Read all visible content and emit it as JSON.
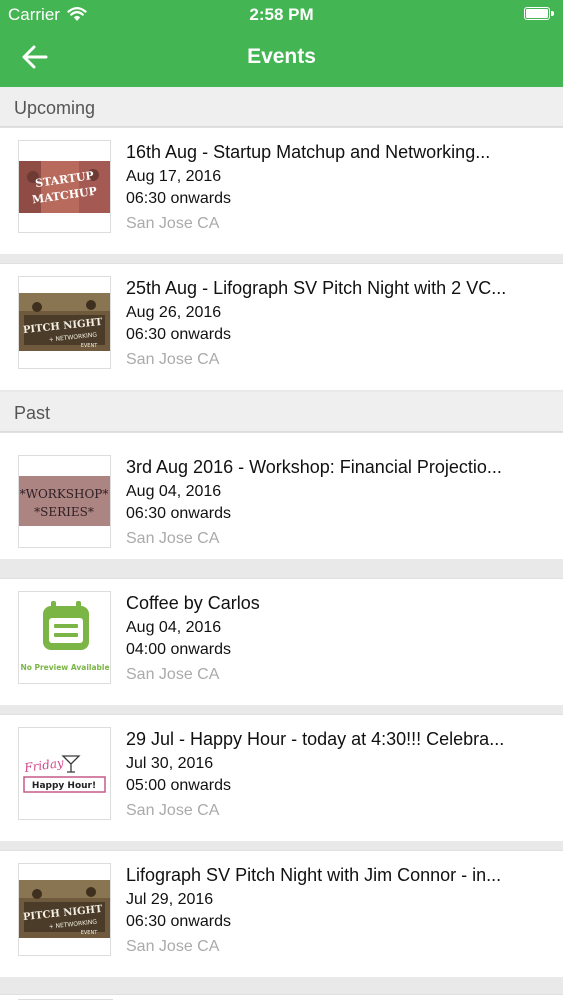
{
  "status_bar": {
    "carrier": "Carrier",
    "time": "2:58 PM"
  },
  "header": {
    "title": "Events"
  },
  "sections": [
    {
      "label": "Upcoming",
      "events": [
        {
          "title": "16th Aug - Startup Matchup and Networking...",
          "date": "Aug 17, 2016",
          "time": "06:30 onwards",
          "location": "San Jose CA",
          "thumb_text": [
            "STARTUP",
            "MATCHUP"
          ]
        },
        {
          "title": "25th Aug - Lifograph SV Pitch Night with 2 VC...",
          "date": "Aug 26, 2016",
          "time": "06:30 onwards",
          "location": "San Jose CA",
          "thumb_text": [
            "PITCH NIGHT",
            "+ NETWORKING",
            "EVENT"
          ]
        }
      ]
    },
    {
      "label": "Past",
      "events": [
        {
          "title": "3rd Aug 2016 - Workshop: Financial Projectio...",
          "date": "Aug 04, 2016",
          "time": "06:30 onwards",
          "location": "San Jose CA",
          "thumb_text": [
            "*WORKSHOP*",
            "*SERIES*"
          ]
        },
        {
          "title": "Coffee by Carlos",
          "date": "Aug 04, 2016",
          "time": "04:00 onwards",
          "location": "San Jose CA",
          "thumb_text": [
            "No Preview Available"
          ]
        },
        {
          "title": "29 Jul - Happy Hour - today at 4:30!!! Celebra...",
          "date": "Jul 30, 2016",
          "time": "05:00 onwards",
          "location": "San Jose CA",
          "thumb_text": [
            "Friday",
            "Happy Hour!"
          ]
        },
        {
          "title": "Lifograph SV Pitch Night with Jim Connor - in...",
          "date": "Jul 29, 2016",
          "time": "06:30 onwards",
          "location": "San Jose CA",
          "thumb_text": [
            "PITCH NIGHT",
            "+ NETWORKING",
            "EVENT"
          ]
        }
      ]
    }
  ],
  "colors": {
    "header_green": "#44b553",
    "placeholder_green": "#7bb545",
    "location_gray": "#aaaaaa"
  }
}
